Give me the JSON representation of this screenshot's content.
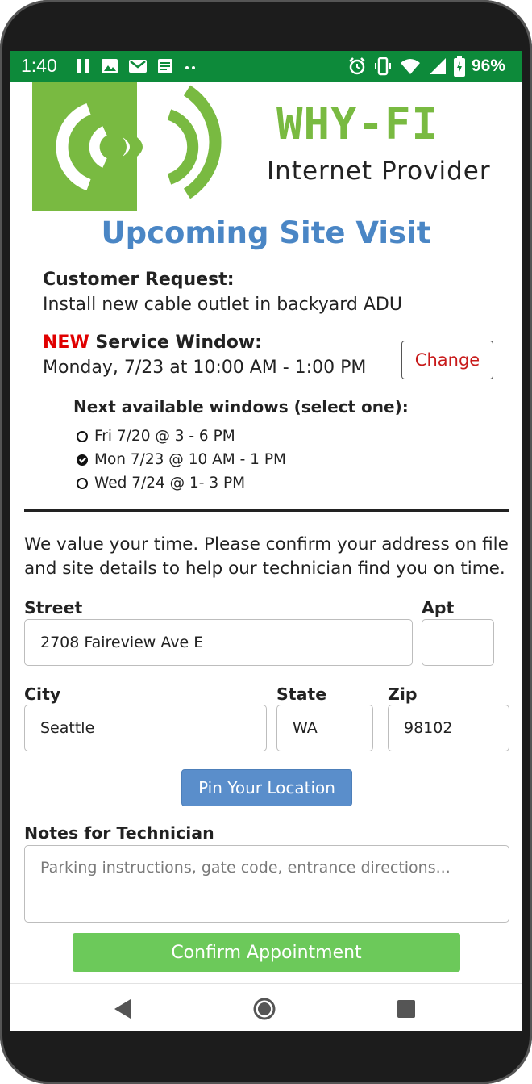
{
  "status_bar": {
    "time": "1:40",
    "battery": "96%",
    "left_icons": [
      "pause-icon",
      "image-icon",
      "gmail-icon",
      "notes-icon",
      "more-dots-icon"
    ],
    "right_icons": [
      "alarm-icon",
      "vibrate-icon",
      "wifi-icon",
      "signal-icon",
      "battery-charging-icon"
    ]
  },
  "brand": {
    "name": "WHY-FI",
    "tagline": "Internet Provider",
    "logo_icon": "wifi-signal-logo",
    "logo_color": "#79ba41"
  },
  "page_title": "Upcoming Site Visit",
  "request": {
    "label": "Customer Request:",
    "value": "Install new cable outlet in backyard ADU"
  },
  "service_window": {
    "new_tag": "NEW",
    "label": "Service Window:",
    "value": "Monday, 7/23 at 10:00 AM - 1:00 PM",
    "change_label": "Change"
  },
  "windows": {
    "heading": "Next available windows (select one):",
    "options": [
      {
        "label": "Fri 7/20 @ 3 - 6 PM",
        "selected": false
      },
      {
        "label": "Mon 7/23 @ 10 AM - 1 PM",
        "selected": true
      },
      {
        "label": "Wed 7/24 @ 1- 3 PM",
        "selected": false
      }
    ]
  },
  "intro_text": "We value your time. Please confirm your address on file and site details to help our technician find you on time.",
  "address": {
    "street_label": "Street",
    "street_value": "2708 Faireview Ave E",
    "apt_label": "Apt",
    "apt_value": "",
    "city_label": "City",
    "city_value": "Seattle",
    "state_label": "State",
    "state_value": "WA",
    "zip_label": "Zip",
    "zip_value": "98102"
  },
  "pin_button": "Pin Your Location",
  "notes": {
    "label": "Notes for Technician",
    "placeholder": "Parking instructions, gate code, entrance directions..."
  },
  "confirm_button": "Confirm Appointment",
  "nav": [
    "back-icon",
    "home-icon",
    "recents-icon"
  ],
  "colors": {
    "status_bar": "#0d8a3a",
    "title_blue": "#4a86c5",
    "brand_green": "#79ba41",
    "pin_button": "#5a8ecb",
    "confirm_button": "#6cc95a",
    "new_red": "#e00000"
  }
}
